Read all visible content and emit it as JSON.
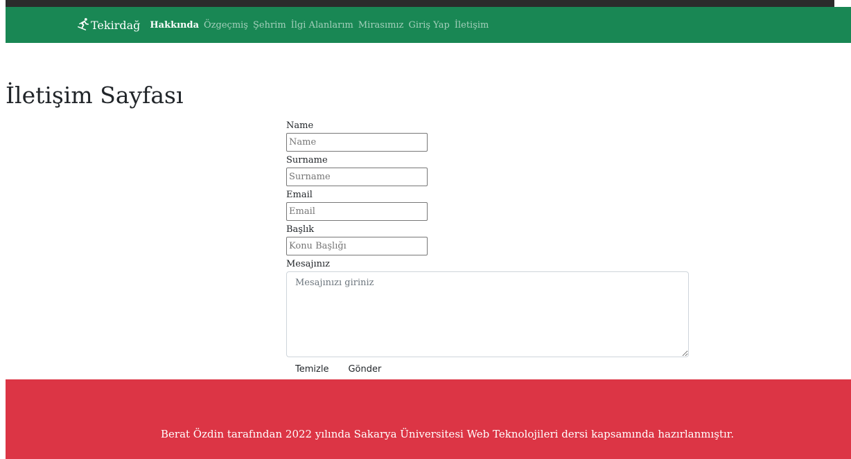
{
  "navbar": {
    "brand_label": "Tekirdağ",
    "brand_icon": "person-skiing-icon",
    "links": [
      {
        "label": "Hakkında",
        "active": true
      },
      {
        "label": "Özgeçmiş",
        "active": false
      },
      {
        "label": "Şehrim",
        "active": false
      },
      {
        "label": "İlgi Alanlarım",
        "active": false
      },
      {
        "label": "Mirasımız",
        "active": false
      },
      {
        "label": "Giriş Yap",
        "active": false
      },
      {
        "label": "İletişim",
        "active": false
      }
    ]
  },
  "page": {
    "title": "İletişim Sayfası"
  },
  "form": {
    "name": {
      "label": "Name",
      "placeholder": "Name",
      "value": ""
    },
    "surname": {
      "label": "Surname",
      "placeholder": "Surname",
      "value": ""
    },
    "email": {
      "label": "Email",
      "placeholder": "Email",
      "value": ""
    },
    "subject": {
      "label": "Başlık",
      "placeholder": "Konu Başlığı",
      "value": ""
    },
    "message": {
      "label": "Mesajınız",
      "placeholder": "Mesajınızı giriniz",
      "value": ""
    },
    "reset_label": "Temizle",
    "submit_label": "Gönder"
  },
  "footer": {
    "text": "Berat Özdin tarafından 2022 yılında Sakarya Üniversitesi Web Teknolojileri dersi kapsamında hazırlanmıştır."
  },
  "colors": {
    "navbar_bg": "#198754",
    "footer_bg": "#dc3545",
    "nav_active": "#ffffff",
    "nav_inactive": "#a3cfbb"
  }
}
